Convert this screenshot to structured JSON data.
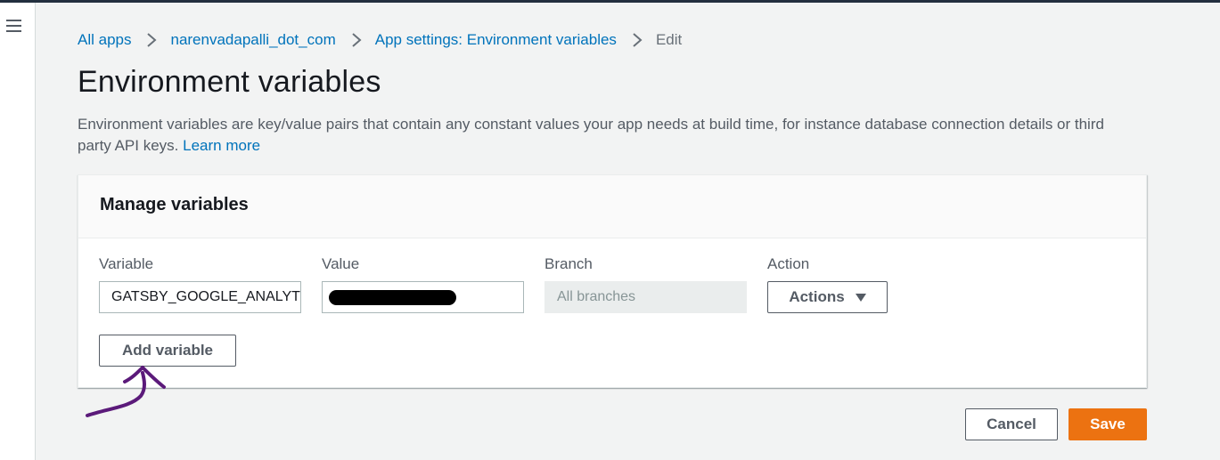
{
  "breadcrumb": {
    "items": [
      "All apps",
      "narenvadapalli_dot_com",
      "App settings: Environment variables"
    ],
    "current": "Edit"
  },
  "page": {
    "title": "Environment variables",
    "description": "Environment variables are key/value pairs that contain any constant values your app needs at build time, for instance database connection details or third party API keys.",
    "learn_more": "Learn more"
  },
  "panel": {
    "title": "Manage variables",
    "columns": {
      "variable": "Variable",
      "value": "Value",
      "branch": "Branch",
      "action": "Action"
    },
    "row": {
      "variable": "GATSBY_GOOGLE_ANALYTICS",
      "branch_placeholder": "All branches",
      "actions_label": "Actions"
    },
    "add_variable_label": "Add variable"
  },
  "footer": {
    "cancel_label": "Cancel",
    "save_label": "Save"
  },
  "colors": {
    "link": "#0073bb",
    "primary": "#ec7211",
    "annotation": "#5b1a7a"
  },
  "icons": [
    "menu-icon",
    "chevron-right-icon",
    "caret-down-icon",
    "arrow-annotation"
  ]
}
